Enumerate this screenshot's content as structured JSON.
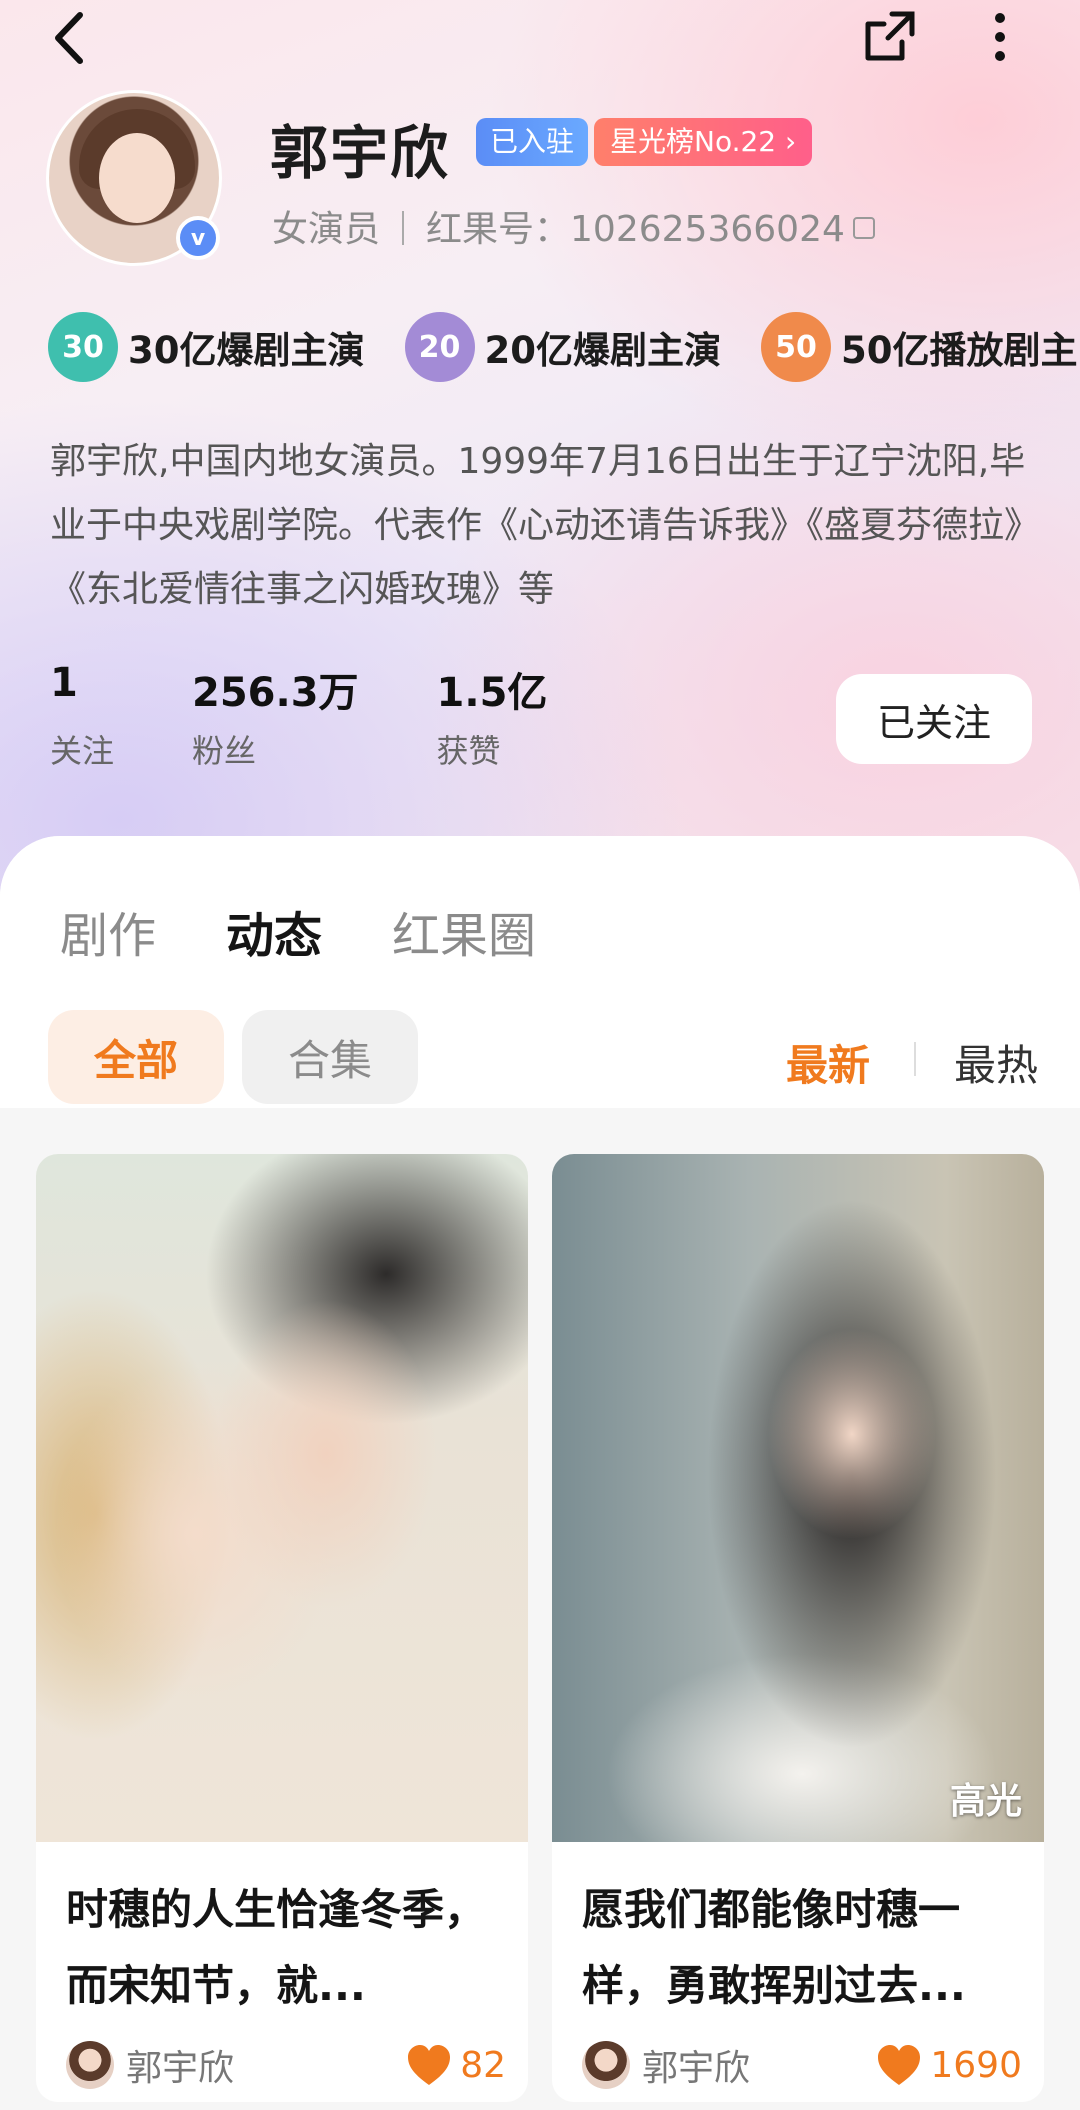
{
  "header": {
    "name": "郭宇欣",
    "tag_settled": "已入驻",
    "tag_rank": "星光榜No.22",
    "role": "女演员",
    "id_label": "红果号：",
    "id_value": "102625366024"
  },
  "honors": [
    {
      "badge": "30",
      "label": "30亿爆剧主演",
      "color": "#3fbfae"
    },
    {
      "badge": "20",
      "label": "20亿爆剧主演",
      "color": "#a38bd6"
    },
    {
      "badge": "50",
      "label": "50亿播放剧主",
      "color": "#f08a4b"
    }
  ],
  "bio": "郭宇欣,中国内地女演员。1999年7月16日出生于辽宁沈阳,毕业于中央戏剧学院。代表作《心动还请告诉我》《盛夏芬德拉》《东北爱情往事之闪婚玫瑰》等",
  "stats": [
    {
      "value": "1",
      "label": "关注"
    },
    {
      "value": "256.3万",
      "label": "粉丝"
    },
    {
      "value": "1.5亿",
      "label": "获赞"
    }
  ],
  "follow_button": "已关注",
  "tabs": [
    {
      "label": "剧作",
      "active": false
    },
    {
      "label": "动态",
      "active": true
    },
    {
      "label": "红果圈",
      "active": false
    }
  ],
  "filters": {
    "all": "全部",
    "collection": "合集"
  },
  "sort": {
    "newest": "最新",
    "hottest": "最热"
  },
  "cards": [
    {
      "title": "时穗的人生恰逢冬季，而宋知节，就...",
      "author": "郭宇欣",
      "likes": "82",
      "badge": ""
    },
    {
      "title": "愿我们都能像时穗一样，勇敢挥别过去...",
      "author": "郭宇欣",
      "likes": "1690",
      "badge": "高光"
    }
  ],
  "colors": {
    "accent": "#f07a1e",
    "verified": "#5b8df6"
  }
}
